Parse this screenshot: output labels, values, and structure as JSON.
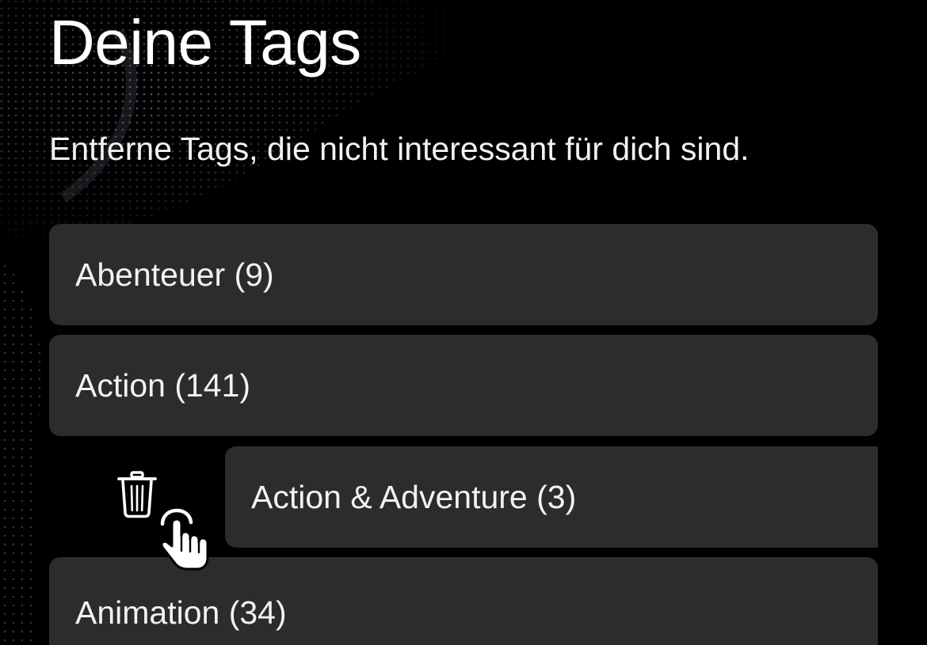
{
  "header": {
    "title": "Deine Tags",
    "subtitle": "Entferne Tags, die nicht interessant für dich sind."
  },
  "tags": [
    {
      "label": "Abenteuer (9)"
    },
    {
      "label": "Action (141)"
    },
    {
      "label": "Action & Adventure (3)",
      "swiped": true
    },
    {
      "label": "Animation (34)"
    }
  ],
  "swipe_action": {
    "icon": "trash-icon",
    "action": "delete"
  },
  "colors": {
    "background": "#000000",
    "row_background": "#2c2c2e",
    "text": "#f2f2f2"
  }
}
